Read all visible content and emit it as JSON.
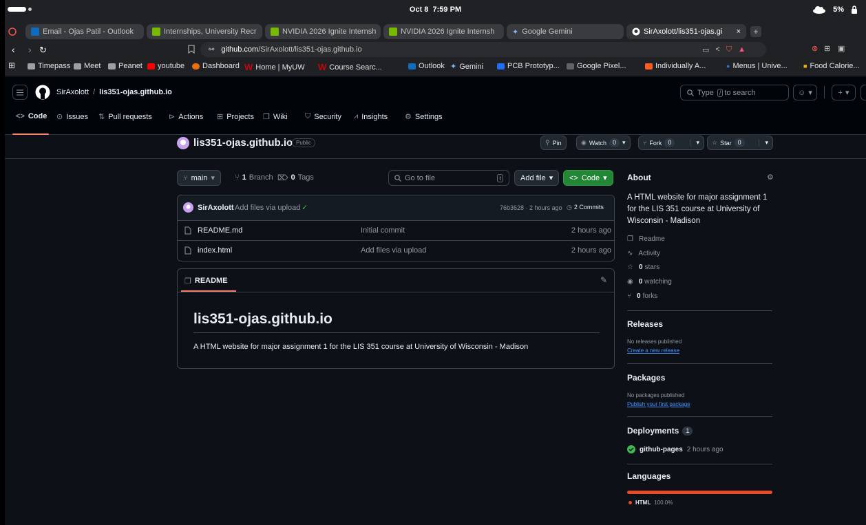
{
  "statusbar": {
    "date": "Oct 8",
    "time": "7:59 PM",
    "battery": "5%"
  },
  "tabs": [
    {
      "label": "Email - Ojas Patil - Outlook",
      "color": "#0f6cbd"
    },
    {
      "label": "Internships, University Recr",
      "color": "#76b900"
    },
    {
      "label": "NVIDIA 2026 Ignite Internsh",
      "color": "#76b900"
    },
    {
      "label": "NVIDIA 2026 Ignite Internsh",
      "color": "#76b900"
    },
    {
      "label": "Google Gemini",
      "color": "#8ab4f8"
    },
    {
      "label": "SirAxolott/lis351-ojas.gi",
      "color": "#ffffff"
    }
  ],
  "tab_close": "×",
  "tab_new": "+",
  "url": {
    "prefix": "github.com",
    "rest": "/SirAxolott/lis351-ojas.github.io"
  },
  "bookmarks": [
    {
      "label": "Timepass",
      "color": "#9aa0a6"
    },
    {
      "label": "Meet",
      "color": "#9aa0a6"
    },
    {
      "label": "Peanet",
      "color": "#9aa0a6"
    },
    {
      "label": "youtube",
      "color": "#ff0000"
    },
    {
      "label": "Dashboard",
      "color": "#e8710a"
    },
    {
      "label": "Home | MyUW",
      "color": "#c5050c"
    },
    {
      "label": "Course Searc...",
      "color": "#c5050c"
    },
    {
      "label": "Outlook",
      "color": "#0f6cbd"
    },
    {
      "label": "Gemini",
      "color": "#8ab4f8"
    },
    {
      "label": "PCB Prototyp...",
      "color": "#1e6ff1"
    },
    {
      "label": "Google Pixel...",
      "color": "#5f6368"
    },
    {
      "label": "Individually A...",
      "color": "#ff5a1f"
    },
    {
      "label": "Menus | Unive...",
      "color": "#2f6fd6"
    },
    {
      "label": "Food Calorie...",
      "color": "#f6b100"
    }
  ],
  "github": {
    "owner": "SirAxolott",
    "separator": "/",
    "repo": "lis351-ojas.github.io",
    "search_prefix": "Type",
    "search_key": "/",
    "search_suffix": "to search",
    "plus": "+",
    "nav": [
      "Code",
      "Issues",
      "Pull requests",
      "Actions",
      "Projects",
      "Wiki",
      "Security",
      "Insights",
      "Settings"
    ]
  },
  "repo_header": {
    "name": "lis351-ojas.github.io",
    "visibility": "Public",
    "pin": "Pin",
    "watch": "Watch",
    "watch_count": "0",
    "fork": "Fork",
    "fork_count": "0",
    "star": "Star",
    "star_count": "0"
  },
  "toolbar": {
    "branch": "main",
    "branch_count": "1",
    "branch_label": "Branch",
    "tag_count": "0",
    "tag_label": "Tags",
    "goto_placeholder": "Go to file",
    "goto_key": "t",
    "add_file": "Add file",
    "code": "Code"
  },
  "commit": {
    "author": "SirAxolott",
    "message": "Add files via upload",
    "hash_time": "76b3628 · 2 hours ago",
    "commits": "2 Commits"
  },
  "files": [
    {
      "name": "README.md",
      "message": "Initial commit",
      "time": "2 hours ago"
    },
    {
      "name": "index.html",
      "message": "Add files via upload",
      "time": "2 hours ago"
    }
  ],
  "readme": {
    "tab": "README",
    "heading": "lis351-ojas.github.io",
    "body": "A HTML website for major assignment 1 for the LIS 351 course at University of Wisconsin - Madison"
  },
  "about": {
    "title": "About",
    "description": "A HTML website for major assignment 1 for the LIS 351 course at University of Wisconsin - Madison",
    "readme": "Readme",
    "activity": "Activity",
    "stars_count": "0",
    "stars": "stars",
    "watching_count": "0",
    "watching": "watching",
    "forks_count": "0",
    "forks": "forks"
  },
  "releases": {
    "title": "Releases",
    "none": "No releases published",
    "link": "Create a new release"
  },
  "packages": {
    "title": "Packages",
    "none": "No packages published",
    "link": "Publish your first package"
  },
  "deployments": {
    "title": "Deployments",
    "count": "1",
    "env": "github-pages",
    "time": "2 hours ago"
  },
  "languages": {
    "title": "Languages",
    "name": "HTML",
    "percent": "100.0%",
    "share": 1.0,
    "color": "#e34c26"
  }
}
